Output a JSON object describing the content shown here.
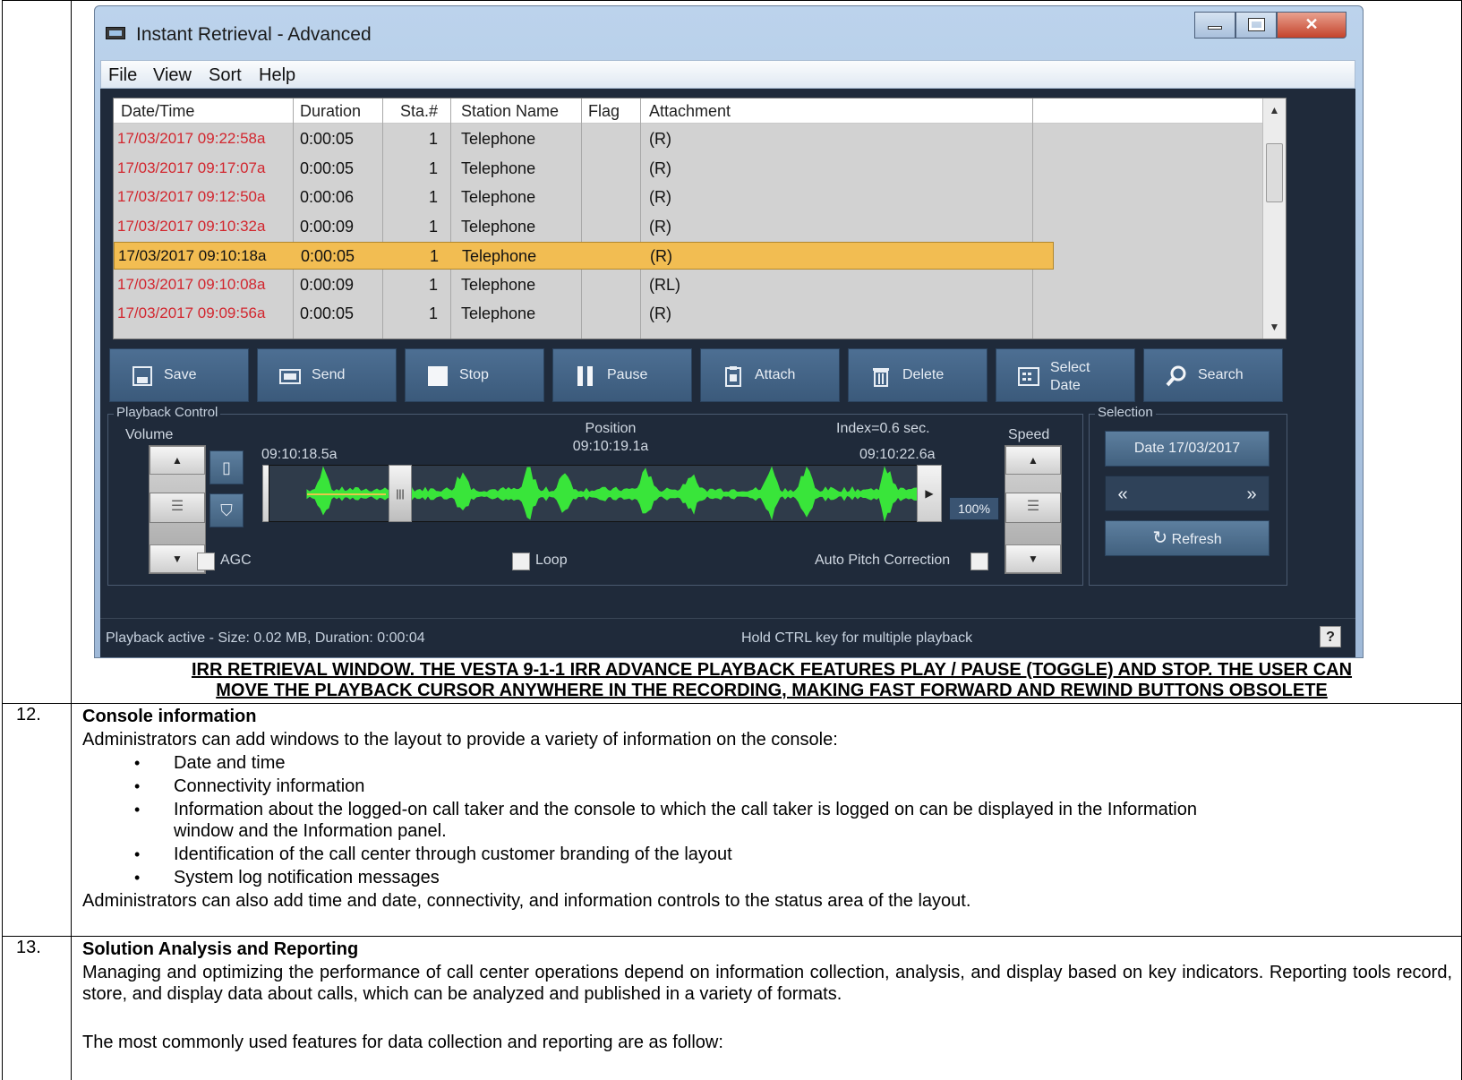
{
  "window": {
    "title": "Instant Retrieval - Advanced",
    "menu": [
      "File",
      "View",
      "Sort",
      "Help"
    ],
    "columns": [
      "Date/Time",
      "Duration",
      "Sta.#",
      "Station Name",
      "Flag",
      "Attachment"
    ],
    "rows": [
      {
        "datetime": "17/03/2017 09:22:58a",
        "duration": "0:00:05",
        "sta": "1",
        "station": "Telephone",
        "flag": "",
        "attachment": "(R)"
      },
      {
        "datetime": "17/03/2017 09:17:07a",
        "duration": "0:00:05",
        "sta": "1",
        "station": "Telephone",
        "flag": "",
        "attachment": "(R)"
      },
      {
        "datetime": "17/03/2017 09:12:50a",
        "duration": "0:00:06",
        "sta": "1",
        "station": "Telephone",
        "flag": "",
        "attachment": "(R)"
      },
      {
        "datetime": "17/03/2017 09:10:32a",
        "duration": "0:00:09",
        "sta": "1",
        "station": "Telephone",
        "flag": "",
        "attachment": "(R)"
      },
      {
        "datetime": "17/03/2017 09:10:18a",
        "duration": "0:00:05",
        "sta": "1",
        "station": "Telephone",
        "flag": "",
        "attachment": "(R)"
      },
      {
        "datetime": "17/03/2017 09:10:08a",
        "duration": "0:00:09",
        "sta": "1",
        "station": "Telephone",
        "flag": "",
        "attachment": "(RL)"
      },
      {
        "datetime": "17/03/2017 09:09:56a",
        "duration": "0:00:05",
        "sta": "1",
        "station": "Telephone",
        "flag": "",
        "attachment": "(R)"
      }
    ],
    "selected_row": 4,
    "buttons": {
      "save": "Save",
      "send": "Send",
      "stop": "Stop",
      "pause": "Pause",
      "attach": "Attach",
      "delete": "Delete",
      "select_date_1": "Select",
      "select_date_2": "Date",
      "search": "Search"
    },
    "playback": {
      "group_title": "Playback Control",
      "volume": "Volume",
      "speed": "Speed",
      "position_label": "Position",
      "position_value": "09:10:19.1a",
      "start_time": "09:10:18.5a",
      "index_label": "Index=0.6 sec.",
      "end_time": "09:10:22.6a",
      "zoom": "100%",
      "agc": "AGC",
      "loop": "Loop",
      "auto_pitch": "Auto Pitch Correction"
    },
    "selection": {
      "group_title": "Selection",
      "date_button": "Date 17/03/2017",
      "rewind": "«",
      "forward": "»",
      "refresh": "Refresh"
    },
    "status": {
      "left": "Playback active - Size: 0.02 MB, Duration: 0:00:04",
      "center": "Hold CTRL key for multiple playback",
      "help": "?"
    }
  },
  "document": {
    "caption_line1": "IRR RETRIEVAL WINDOW. THE VESTA 9-1-1 IRR ADVANCE PLAYBACK FEATURES PLAY / PAUSE (TOGGLE) AND STOP.  THE USER CAN",
    "caption_line2": "MOVE THE PLAYBACK CURSOR ANYWHERE IN THE RECORDING, MAKING FAST FORWARD AND REWIND BUTTONS OBSOLETE",
    "section12": {
      "number": "12.",
      "heading": "Console information",
      "intro": "Administrators can add windows to the layout to provide a variety of information on the console:",
      "bullets": [
        "Date and time",
        "Connectivity information",
        "Information about the logged-on call taker and the console to which the call taker is logged on can be displayed in the Information",
        "window and the Information panel.",
        "Identification of the call center through customer branding of the layout",
        "System log notification messages"
      ],
      "outro": "Administrators can also add time and date, connectivity, and information controls to the status area of the layout."
    },
    "section13": {
      "number": "13.",
      "heading": "Solution Analysis and Reporting",
      "para1": "Managing and optimizing the performance of call center operations depend on information collection, analysis, and display based on key indicators. Reporting tools record, store, and display data about calls, which can be analyzed and published in a variety of formats.",
      "para2": "The most commonly used features for data collection and reporting are as follow:"
    }
  }
}
